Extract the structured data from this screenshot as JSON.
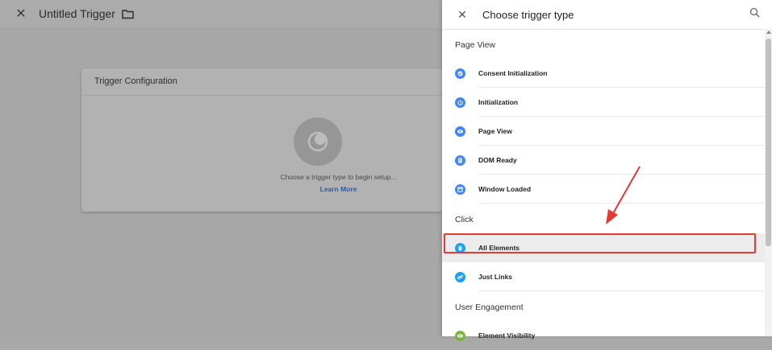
{
  "editor": {
    "title": "Untitled Trigger",
    "card_title": "Trigger Configuration",
    "placeholder_text": "Choose a trigger type to begin setup...",
    "learn_more": "Learn More"
  },
  "panel": {
    "title": "Choose trigger type",
    "sections": [
      {
        "title": "Page View",
        "items": [
          {
            "label": "Consent Initialization",
            "icon": "consent-icon",
            "color": "#4285f4"
          },
          {
            "label": "Initialization",
            "icon": "power-icon",
            "color": "#4285f4"
          },
          {
            "label": "Page View",
            "icon": "eye-icon",
            "color": "#4285f4"
          },
          {
            "label": "DOM Ready",
            "icon": "document-icon",
            "color": "#4285f4"
          },
          {
            "label": "Window Loaded",
            "icon": "window-icon",
            "color": "#4285f4"
          }
        ]
      },
      {
        "title": "Click",
        "items": [
          {
            "label": "All Elements",
            "icon": "mouse-icon",
            "color": "#1ea0f2"
          },
          {
            "label": "Just Links",
            "icon": "link-icon",
            "color": "#1ea0f2"
          }
        ]
      },
      {
        "title": "User Engagement",
        "items": [
          {
            "label": "Element Visibility",
            "icon": "visibility-icon",
            "color": "#7cb342"
          }
        ]
      }
    ]
  },
  "colors": {
    "accent_blue": "#4285f4",
    "click_blue": "#1ea0f2",
    "engagement_green": "#7cb342",
    "highlight_red": "#e53935"
  }
}
